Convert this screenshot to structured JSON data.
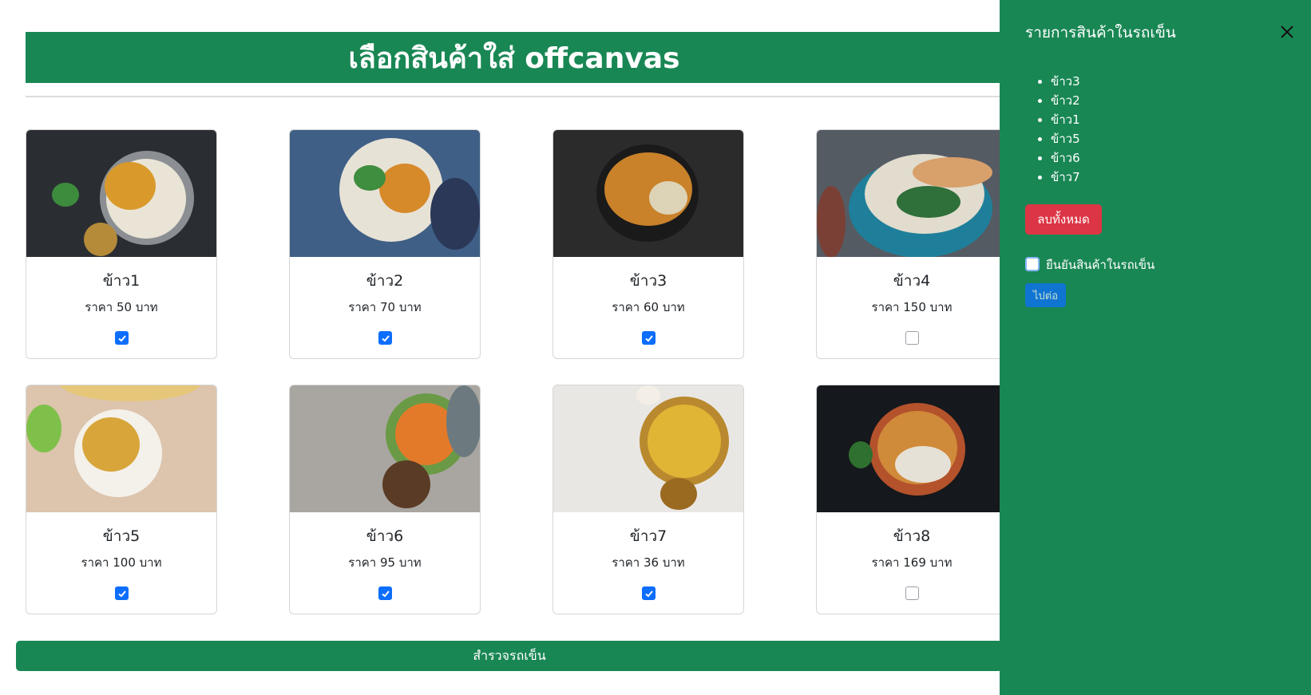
{
  "header": {
    "title": "เลือกสินค้าใส่ offcanvas"
  },
  "products": [
    {
      "name": "ข้าว1",
      "price": "ราคา 50 บาท",
      "checked": true
    },
    {
      "name": "ข้าว2",
      "price": "ราคา 70 บาท",
      "checked": true
    },
    {
      "name": "ข้าว3",
      "price": "ราคา 60 บาท",
      "checked": true
    },
    {
      "name": "ข้าว4",
      "price": "ราคา 150 บาท",
      "checked": false
    },
    {
      "name": "ข้าว5",
      "price": "ราคา 100 บาท",
      "checked": true
    },
    {
      "name": "ข้าว6",
      "price": "ราคา 95 บาท",
      "checked": true
    },
    {
      "name": "ข้าว7",
      "price": "ราคา 36 บาท",
      "checked": true
    },
    {
      "name": "ข้าว8",
      "price": "ราคา 169 บาท",
      "checked": false
    }
  ],
  "cart_button": {
    "label": "สำรวจรถเข็น"
  },
  "offcanvas": {
    "title": "รายการสินค้าในรถเข็น",
    "items": [
      "ข้าว3",
      "ข้าว2",
      "ข้าว1",
      "ข้าว5",
      "ข้าว6",
      "ข้าว7"
    ],
    "delete_all_label": "ลบทั้งหมด",
    "confirm_label": "ยืนยันสินค้าในรถเข็น",
    "confirm_checked": false,
    "next_label": "ไปต่อ"
  },
  "colors": {
    "primary_green": "#198754",
    "danger": "#dc3545",
    "checkbox_blue": "#0d6efd"
  }
}
